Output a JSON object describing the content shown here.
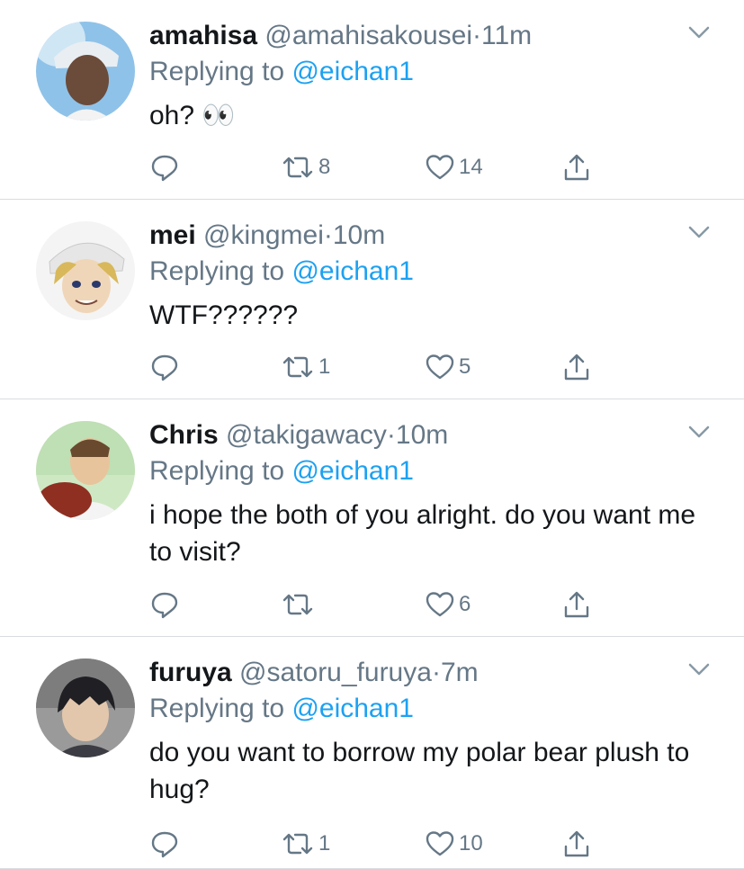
{
  "colors": {
    "link": "#1da1f2",
    "secondary": "#657786",
    "divider": "#d9dde0"
  },
  "icons": [
    "reply-icon",
    "retweet-icon",
    "like-icon",
    "share-icon",
    "chevron-down-icon"
  ],
  "tweets": [
    {
      "name": "amahisa",
      "handle": "@amahisakousei",
      "dot": "·",
      "time": "11m",
      "replying_prefix": "Replying to ",
      "replying_to": "@eichan1",
      "text": "oh? 👀",
      "retweets": "8",
      "likes": "14"
    },
    {
      "name": "mei",
      "handle": "@kingmei",
      "dot": "·",
      "time": "10m",
      "replying_prefix": "Replying to ",
      "replying_to": "@eichan1",
      "text": "WTF??????",
      "retweets": "1",
      "likes": "5"
    },
    {
      "name": "Chris",
      "handle": "@takigawacy",
      "dot": "·",
      "time": "10m",
      "replying_prefix": "Replying to ",
      "replying_to": "@eichan1",
      "text": "i hope the both of you alright. do you want me to visit?",
      "retweets": "",
      "likes": "6"
    },
    {
      "name": "furuya",
      "handle": "@satoru_furuya",
      "dot": "·",
      "time": "7m",
      "replying_prefix": "Replying to ",
      "replying_to": "@eichan1",
      "text": "do you want to borrow my polar bear plush to hug?",
      "retweets": "1",
      "likes": "10"
    }
  ]
}
